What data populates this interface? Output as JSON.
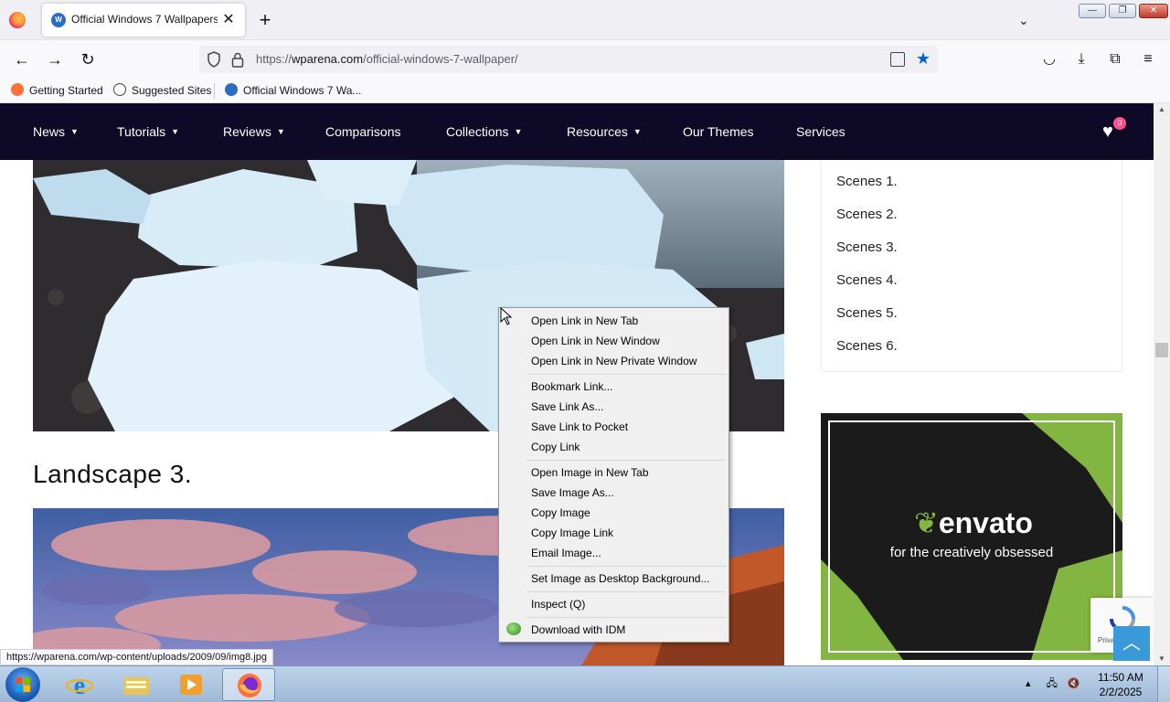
{
  "browser": {
    "tab": {
      "title": "Official Windows 7 Wallpapers",
      "favicon_text": "W"
    },
    "url": {
      "prefix": "https://",
      "domain": "wparena.com",
      "path": "/official-windows-7-wallpaper/"
    },
    "bookmarks": [
      {
        "label": "Getting Started"
      },
      {
        "label": "Suggested Sites"
      },
      {
        "label": "Official Windows 7 Wa..."
      }
    ],
    "status_url": "https://wparena.com/wp-content/uploads/2009/09/img8.jpg"
  },
  "site_nav": {
    "items": [
      {
        "label": "News",
        "has_dropdown": true
      },
      {
        "label": "Tutorials",
        "has_dropdown": true
      },
      {
        "label": "Reviews",
        "has_dropdown": true
      },
      {
        "label": "Comparisons",
        "has_dropdown": false
      },
      {
        "label": "Collections",
        "has_dropdown": true
      },
      {
        "label": "Resources",
        "has_dropdown": true
      },
      {
        "label": "Our Themes",
        "has_dropdown": false
      },
      {
        "label": "Services",
        "has_dropdown": false
      }
    ],
    "wishlist_count": "0",
    "caret": "▼"
  },
  "content": {
    "heading": "Landscape 3.",
    "toc": [
      "Scenes 1.",
      "Scenes 2.",
      "Scenes 3.",
      "Scenes 4.",
      "Scenes 5.",
      "Scenes 6."
    ],
    "ad": {
      "brand": "envato",
      "tagline": "for the creatively obsessed"
    },
    "recaptcha_text": "Priva"
  },
  "context_menu": {
    "groups": [
      [
        "Open Link in New Tab",
        "Open Link in New Window",
        "Open Link in New Private Window"
      ],
      [
        "Bookmark Link...",
        "Save Link As...",
        "Save Link to Pocket",
        "Copy Link"
      ],
      [
        "Open Image in New Tab",
        "Save Image As...",
        "Copy Image",
        "Copy Image Link",
        "Email Image..."
      ],
      [
        "Set Image as Desktop Background..."
      ],
      [
        "Inspect (Q)"
      ],
      [
        "Download with IDM"
      ]
    ]
  },
  "taskbar": {
    "time": "11:50 AM",
    "date": "2/2/2025"
  },
  "colors": {
    "site_nav_bg": "#0d0926",
    "accent_star": "#0061e0",
    "envato_green": "#82b541",
    "to_top": "#3a9ad9"
  }
}
